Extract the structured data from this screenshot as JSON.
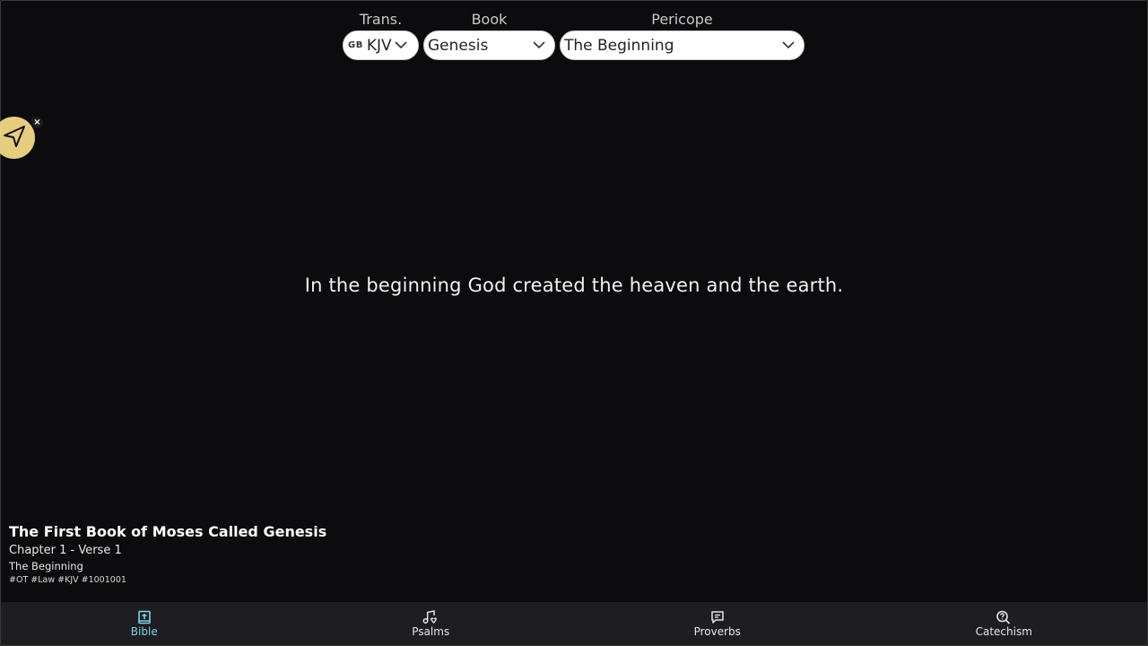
{
  "header": {
    "translation": {
      "label": "Trans.",
      "flag": "GB",
      "value": "KJV"
    },
    "book": {
      "label": "Book",
      "value": "Genesis"
    },
    "pericope": {
      "label": "Pericope",
      "value": "The Beginning"
    }
  },
  "share": {
    "close_glyph": "×",
    "icon": "send-icon",
    "color": "#e7cd7f"
  },
  "verse": {
    "text": "In the beginning God created the heaven and the earth."
  },
  "meta": {
    "book_title": "The First Book of Moses Called Genesis",
    "chapter_verse": "Chapter 1 - Verse 1",
    "pericope": "The Beginning",
    "tags": "#OT #Law #KJV #1001001"
  },
  "nav": {
    "active": "Bible",
    "active_color": "#7fd4e6",
    "items": [
      {
        "label": "Bible",
        "icon": "bible-icon"
      },
      {
        "label": "Psalms",
        "icon": "music-heart-icon"
      },
      {
        "label": "Proverbs",
        "icon": "chat-bubble-icon"
      },
      {
        "label": "Catechism",
        "icon": "search-question-icon"
      }
    ]
  }
}
